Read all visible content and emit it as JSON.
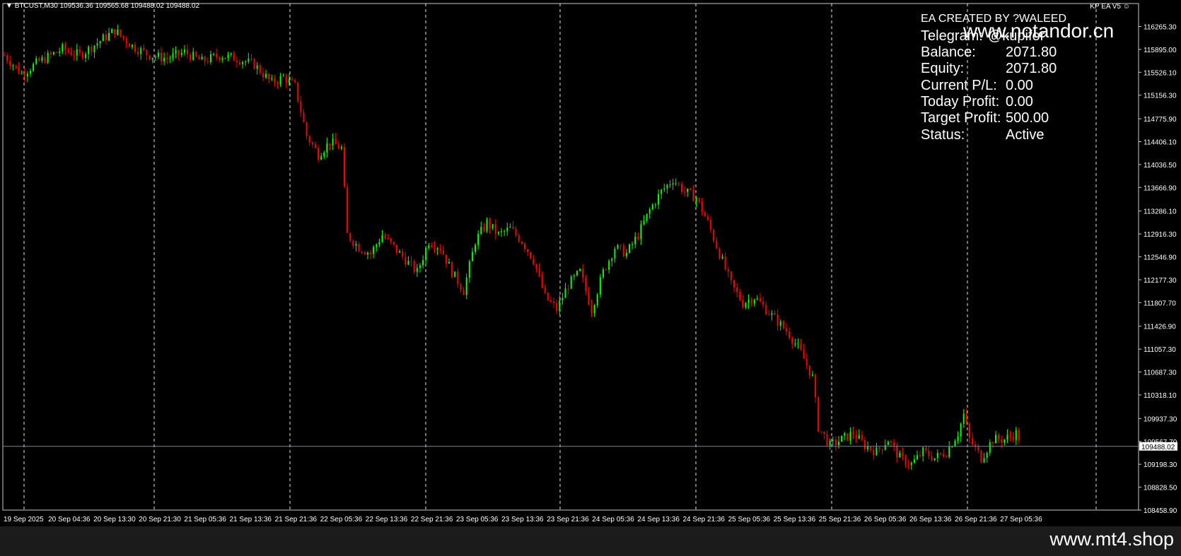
{
  "chart_header": {
    "symbol": "BTCUST,M30",
    "ohlc": "109536.36 109565.68 109488.02 109488.02",
    "menu_icon": "triangle-down-icon"
  },
  "ea_badge": {
    "label": "KP EA V5",
    "icon": "smiley-icon"
  },
  "info_panel": {
    "creator": "EA CREATED BY ?WALEED",
    "rows": [
      {
        "label": "Telegram:",
        "value": "@kupifor"
      },
      {
        "label": "Balance:",
        "value": "2071.80"
      },
      {
        "label": "Equity:",
        "value": "2071.80"
      },
      {
        "label": "Current P/L:",
        "value": "0.00"
      },
      {
        "label": "Today Profit:",
        "value": "0.00"
      },
      {
        "label": "Target Profit:",
        "value": "500.00"
      },
      {
        "label": "Status:",
        "value": "Active"
      }
    ]
  },
  "watermark_overlay": "www.notandor.cn",
  "footer_brand": "www.mt4.shop",
  "colors": {
    "background": "#000000",
    "bull": "#00ff00",
    "bear": "#ff0000",
    "grid": "#ffffff",
    "text": "#ffffff",
    "bid_line": "#778899"
  },
  "chart_data": {
    "type": "candlestick",
    "symbol": "BTCUST",
    "timeframe": "M30",
    "current_price": 109488.02,
    "current_price_label": "109488.02",
    "ylim": [
      108458.9,
      116635.6
    ],
    "y_ticks": [
      "116265.30",
      "115895.00",
      "115526.10",
      "115156.30",
      "114775.90",
      "114406.10",
      "114036.50",
      "113666.90",
      "113286.10",
      "112916.30",
      "112546.90",
      "112177.30",
      "111807.70",
      "111426.90",
      "111057.30",
      "110687.30",
      "110318.10",
      "109937.30",
      "109567.70",
      "109198.30",
      "108828.50",
      "108458.90"
    ],
    "x_ticks": [
      "19 Sep 2025",
      "20 Sep 04:36",
      "20 Sep 13:30",
      "20 Sep 21:30",
      "21 Sep 05:36",
      "21 Sep 13:36",
      "21 Sep 21:36",
      "22 Sep 05:36",
      "22 Sep 13:36",
      "22 Sep 21:36",
      "23 Sep 05:36",
      "23 Sep 13:36",
      "23 Sep 21:36",
      "24 Sep 05:36",
      "24 Sep 13:36",
      "24 Sep 21:36",
      "25 Sep 05:36",
      "25 Sep 13:36",
      "25 Sep 21:36",
      "26 Sep 05:36",
      "26 Sep 13:36",
      "26 Sep 21:36",
      "27 Sep 05:36"
    ],
    "grid": "vertical-dashed",
    "price_path": [
      [
        0,
        115800
      ],
      [
        6,
        115500
      ],
      [
        12,
        115700
      ],
      [
        20,
        115900
      ],
      [
        26,
        115800
      ],
      [
        32,
        116000
      ],
      [
        38,
        116200
      ],
      [
        44,
        115950
      ],
      [
        50,
        115800
      ],
      [
        56,
        115750
      ],
      [
        62,
        115850
      ],
      [
        68,
        115700
      ],
      [
        74,
        115800
      ],
      [
        80,
        115750
      ],
      [
        86,
        115650
      ],
      [
        92,
        115350
      ],
      [
        96,
        115450
      ],
      [
        100,
        115300
      ],
      [
        104,
        114500
      ],
      [
        108,
        114200
      ],
      [
        112,
        114400
      ],
      [
        116,
        114300
      ],
      [
        118,
        112900
      ],
      [
        122,
        112700
      ],
      [
        126,
        112600
      ],
      [
        130,
        112900
      ],
      [
        134,
        112700
      ],
      [
        138,
        112500
      ],
      [
        142,
        112300
      ],
      [
        146,
        112800
      ],
      [
        150,
        112700
      ],
      [
        154,
        112300
      ],
      [
        158,
        112000
      ],
      [
        162,
        112800
      ],
      [
        166,
        113100
      ],
      [
        170,
        112900
      ],
      [
        174,
        113000
      ],
      [
        178,
        112800
      ],
      [
        182,
        112500
      ],
      [
        186,
        111900
      ],
      [
        190,
        111700
      ],
      [
        194,
        112100
      ],
      [
        198,
        112300
      ],
      [
        202,
        111700
      ],
      [
        206,
        112300
      ],
      [
        210,
        112700
      ],
      [
        214,
        112600
      ],
      [
        218,
        112900
      ],
      [
        222,
        113300
      ],
      [
        226,
        113600
      ],
      [
        230,
        113800
      ],
      [
        234,
        113600
      ],
      [
        238,
        113500
      ],
      [
        242,
        113100
      ],
      [
        246,
        112600
      ],
      [
        250,
        112100
      ],
      [
        254,
        111800
      ],
      [
        258,
        111900
      ],
      [
        262,
        111700
      ],
      [
        266,
        111500
      ],
      [
        270,
        111300
      ],
      [
        274,
        111000
      ],
      [
        278,
        110600
      ],
      [
        280,
        109800
      ],
      [
        284,
        109500
      ],
      [
        288,
        109600
      ],
      [
        292,
        109700
      ],
      [
        296,
        109500
      ],
      [
        300,
        109400
      ],
      [
        304,
        109600
      ],
      [
        308,
        109300
      ],
      [
        312,
        109200
      ],
      [
        316,
        109400
      ],
      [
        320,
        109300
      ],
      [
        324,
        109400
      ],
      [
        328,
        109700
      ],
      [
        330,
        110000
      ],
      [
        332,
        109600
      ],
      [
        336,
        109300
      ],
      [
        340,
        109600
      ],
      [
        344,
        109600
      ],
      [
        348,
        109700
      ],
      [
        350,
        109550
      ]
    ],
    "candle_count": 350
  }
}
